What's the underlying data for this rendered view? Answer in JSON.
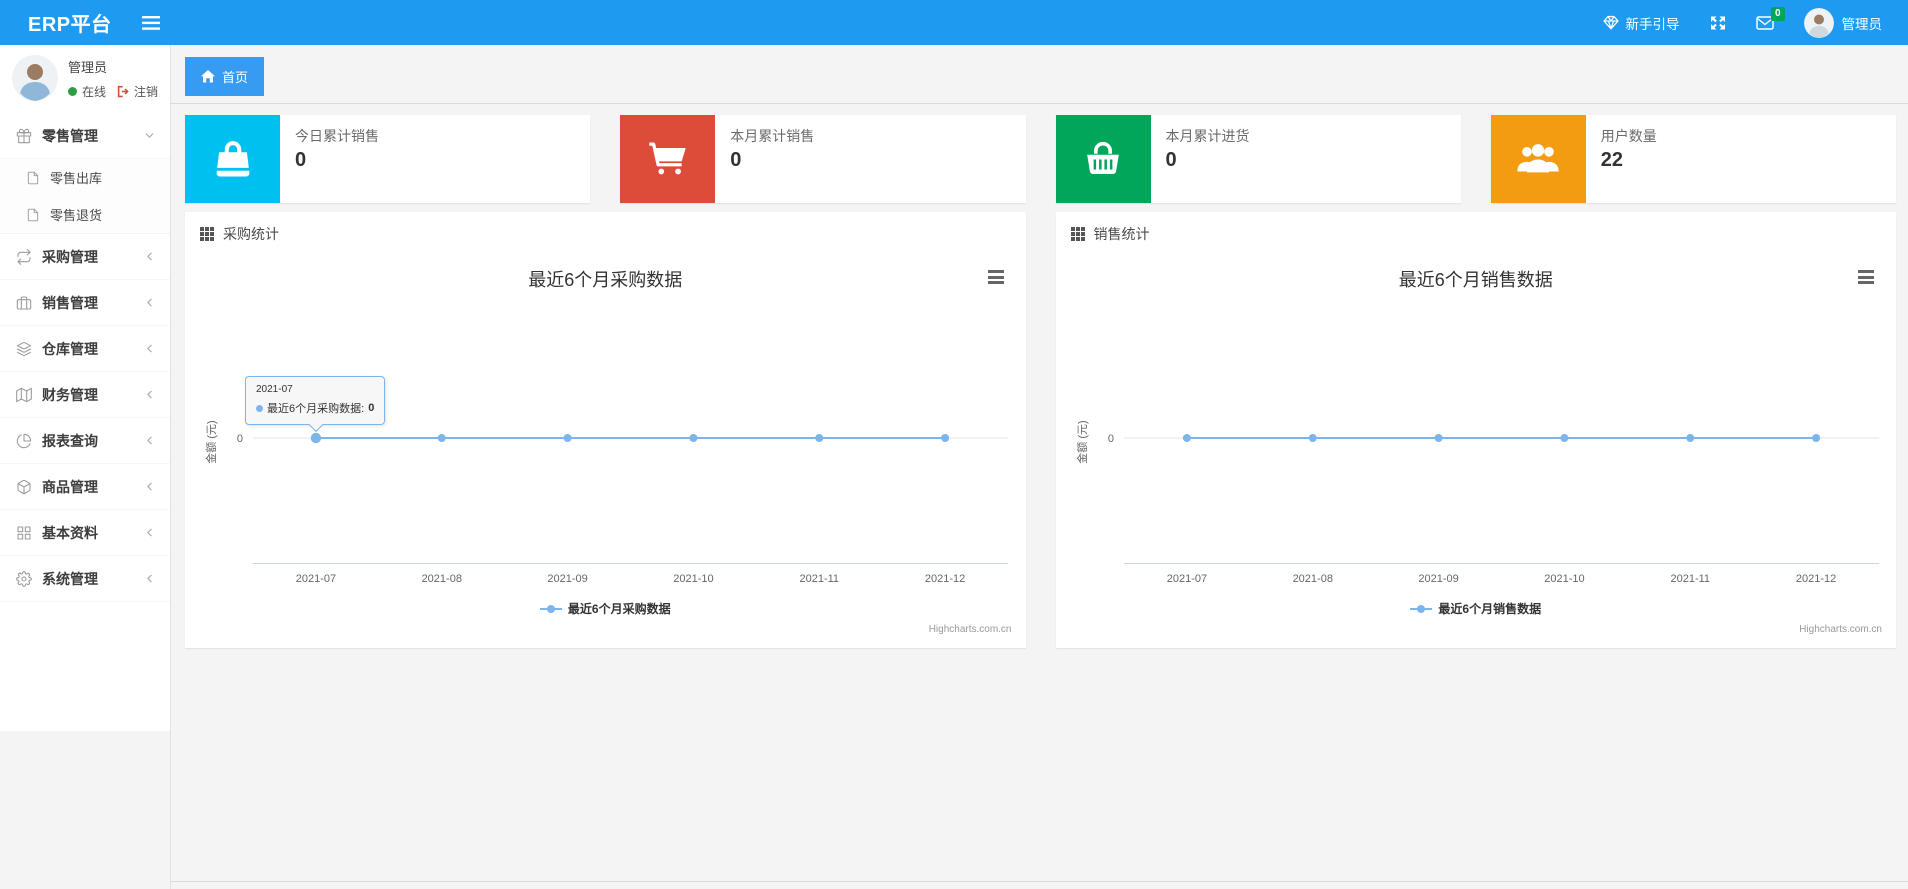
{
  "navbar": {
    "brand": "ERP平台",
    "guide_label": "新手引导",
    "message_badge": "0",
    "username": "管理员",
    "bg_color": "#1e9bf0",
    "badge_color": "#00a65a"
  },
  "sidebar": {
    "user": {
      "name": "管理员",
      "status_label": "在线",
      "logout_label": "注销",
      "status_color": "#2e9e44",
      "logout_color": "#dd4b39"
    },
    "items": [
      {
        "key": "retail",
        "icon": "gift-icon",
        "label": "零售管理",
        "state": "expanded",
        "children": [
          {
            "key": "retail-outbound",
            "icon": "file-icon",
            "label": "零售出库"
          },
          {
            "key": "retail-return",
            "icon": "file-icon",
            "label": "零售退货"
          }
        ]
      },
      {
        "key": "purchase",
        "icon": "repeat-icon",
        "label": "采购管理",
        "state": "collapsed"
      },
      {
        "key": "sales",
        "icon": "briefcase-icon",
        "label": "销售管理",
        "state": "collapsed"
      },
      {
        "key": "warehouse",
        "icon": "layers-icon",
        "label": "仓库管理",
        "state": "collapsed"
      },
      {
        "key": "finance",
        "icon": "map-icon",
        "label": "财务管理",
        "state": "collapsed"
      },
      {
        "key": "report",
        "icon": "pie-chart-icon",
        "label": "报表查询",
        "state": "collapsed"
      },
      {
        "key": "goods",
        "icon": "box-icon",
        "label": "商品管理",
        "state": "collapsed"
      },
      {
        "key": "basic",
        "icon": "grid-icon",
        "label": "基本资料",
        "state": "collapsed"
      },
      {
        "key": "system",
        "icon": "gear-icon",
        "label": "系统管理",
        "state": "collapsed"
      }
    ]
  },
  "breadcrumb": {
    "home_label": "首页"
  },
  "stat_cards": [
    {
      "label": "今日累计销售",
      "value": "0",
      "color": "#00c0ef",
      "icon": "shopping-bag-icon"
    },
    {
      "label": "本月累计销售",
      "value": "0",
      "color": "#dd4b39",
      "icon": "shopping-cart-icon"
    },
    {
      "label": "本月累计进货",
      "value": "0",
      "color": "#00a65a",
      "icon": "shopping-basket-icon"
    },
    {
      "label": "用户数量",
      "value": "22",
      "color": "#f39c12",
      "icon": "users-icon"
    }
  ],
  "panels": [
    {
      "title": "采购统计"
    },
    {
      "title": "销售统计"
    }
  ],
  "chart_data": [
    {
      "type": "line",
      "title": "最近6个月采购数据",
      "categories": [
        "2021-07",
        "2021-08",
        "2021-09",
        "2021-10",
        "2021-11",
        "2021-12"
      ],
      "series": [
        {
          "name": "最近6个月采购数据",
          "color": "#7cb5ec",
          "values": [
            0,
            0,
            0,
            0,
            0,
            0
          ]
        }
      ],
      "xlabel": "",
      "ylabel": "金额 (元)",
      "yticks": [
        "0"
      ],
      "grid": false,
      "legend_position": "bottom",
      "credits": "Highcharts.com.cn",
      "tooltip": {
        "visible": true,
        "category": "2021-07",
        "series_name": "最近6个月采购数据",
        "value": "0"
      }
    },
    {
      "type": "line",
      "title": "最近6个月销售数据",
      "categories": [
        "2021-07",
        "2021-08",
        "2021-09",
        "2021-10",
        "2021-11",
        "2021-12"
      ],
      "series": [
        {
          "name": "最近6个月销售数据",
          "color": "#7cb5ec",
          "values": [
            0,
            0,
            0,
            0,
            0,
            0
          ]
        }
      ],
      "xlabel": "",
      "ylabel": "金额 (元)",
      "yticks": [
        "0"
      ],
      "grid": false,
      "legend_position": "bottom",
      "credits": "Highcharts.com.cn",
      "tooltip": {
        "visible": false
      }
    }
  ]
}
